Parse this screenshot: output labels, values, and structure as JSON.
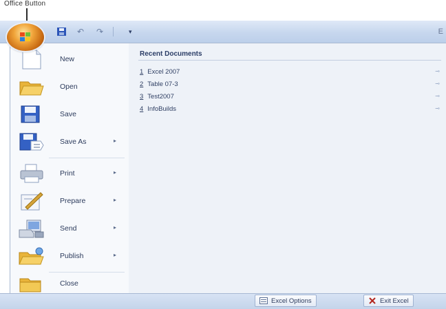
{
  "annotation": {
    "label": "Office Button"
  },
  "title_bar": {
    "title_fragment": "E",
    "quick_access_more": "▾"
  },
  "office_menu": {
    "commands": [
      {
        "label": "New",
        "icon": "new-document-icon",
        "has_arrow": false
      },
      {
        "label": "Open",
        "icon": "open-folder-icon",
        "has_arrow": false
      },
      {
        "label": "Save",
        "icon": "save-disk-icon",
        "has_arrow": false
      },
      {
        "label": "Save As",
        "icon": "save-as-icon",
        "has_arrow": true
      },
      {
        "label": "Print",
        "icon": "printer-icon",
        "has_arrow": true
      },
      {
        "label": "Prepare",
        "icon": "prepare-icon",
        "has_arrow": true
      },
      {
        "label": "Send",
        "icon": "send-icon",
        "has_arrow": true
      },
      {
        "label": "Publish",
        "icon": "publish-icon",
        "has_arrow": true
      },
      {
        "label": "Close",
        "icon": "close-folder-icon",
        "has_arrow": false
      }
    ],
    "arrow_glyph": "▸"
  },
  "recent_documents": {
    "title": "Recent Documents",
    "items": [
      {
        "num": "1",
        "name": "Excel 2007"
      },
      {
        "num": "2",
        "name": "Table 07-3"
      },
      {
        "num": "3",
        "name": "Test2007"
      },
      {
        "num": "4",
        "name": "InfoBuilds"
      }
    ],
    "pin_glyph": "⊸"
  },
  "footer": {
    "options_label": "Excel Options",
    "exit_label": "Exit Excel"
  },
  "colors": {
    "office_button": "#e0892a",
    "menu_background": "#eef2f8",
    "title_bar": "#c7d7ee"
  }
}
